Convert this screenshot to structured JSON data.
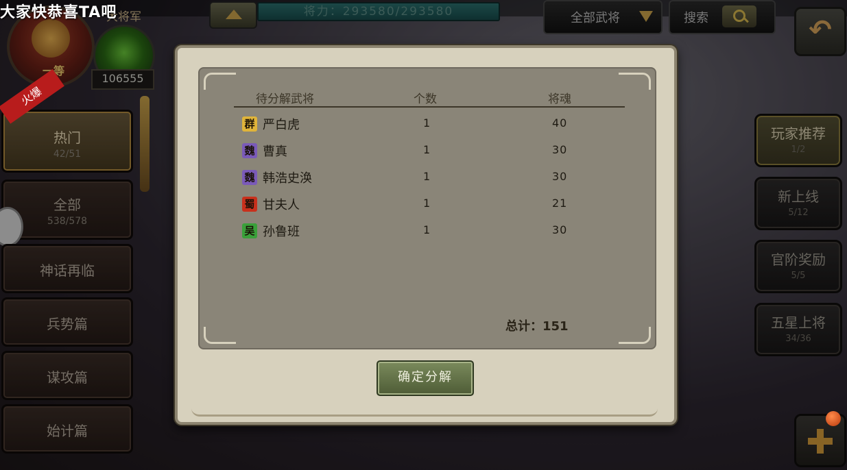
{
  "top": {
    "marquee": "大家快恭喜TA吧",
    "rank_label": "大将军",
    "power_text": "将力：293580/293580",
    "filter_label": "全部武将",
    "search_label": "搜索",
    "avatar_rank": "一等",
    "gem_count": "106555"
  },
  "left_tabs": [
    {
      "title": "热门",
      "sub": "42/51",
      "ribbon": "火爆"
    },
    {
      "title": "全部",
      "sub": "538/578"
    },
    {
      "title": "神话再临"
    },
    {
      "title": "兵势篇"
    },
    {
      "title": "谋攻篇"
    },
    {
      "title": "始计篇"
    }
  ],
  "right_tabs": [
    {
      "title": "玩家推荐",
      "sub": "1/2"
    },
    {
      "title": "新上线",
      "sub": "5/12"
    },
    {
      "title": "官阶奖励",
      "sub": "5/5"
    },
    {
      "title": "五星上将",
      "sub": "34/36"
    }
  ],
  "dialog": {
    "headers": {
      "name": "待分解武将",
      "count": "个数",
      "soul": "将魂"
    },
    "rows": [
      {
        "faction": "群",
        "name": "严白虎",
        "count": "1",
        "soul": "40"
      },
      {
        "faction": "魏",
        "name": "曹真",
        "count": "1",
        "soul": "30"
      },
      {
        "faction": "魏",
        "name": "韩浩史涣",
        "count": "1",
        "soul": "30"
      },
      {
        "faction": "蜀",
        "name": "甘夫人",
        "count": "1",
        "soul": "21"
      },
      {
        "faction": "吴",
        "name": "孙鲁班",
        "count": "1",
        "soul": "30"
      }
    ],
    "total": "总计：151",
    "confirm_label": "确定分解"
  },
  "faction_colors": {
    "群": "#e0b43a",
    "魏": "#7a5ab8",
    "蜀": "#c8301c",
    "吴": "#3aa03a"
  }
}
